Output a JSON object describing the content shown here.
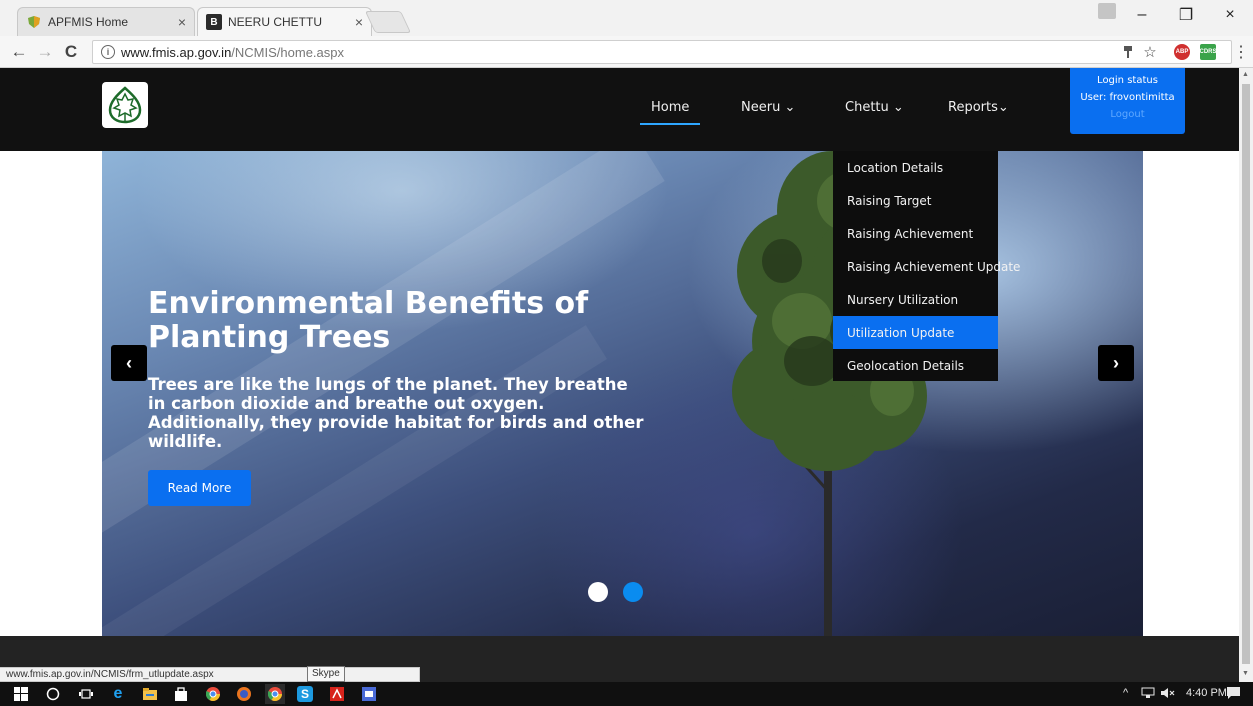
{
  "browser": {
    "tabs": [
      {
        "title": "APFMIS Home",
        "favicon": "shield-favicon",
        "close": "×"
      },
      {
        "title": "NEERU CHETTU",
        "favicon": "b-favicon",
        "favicon_letter": "B",
        "close": "×"
      }
    ],
    "window_controls": {
      "minimize": "–",
      "restore": "❐",
      "close": "×"
    },
    "nav": {
      "back": "←",
      "forward": "→",
      "reload": "C"
    },
    "url_host": "www.fmis.ap.gov.in",
    "url_path": "/NCMIS/home.aspx",
    "info_icon": "i",
    "toolbar_icons": {
      "key": "🗝",
      "star": "☆",
      "menu": "⋮",
      "abp": "ABP",
      "ext2": "CDRS"
    }
  },
  "site": {
    "nav": {
      "home": "Home",
      "neeru": "Neeru",
      "chettu": "Chettu",
      "reports": "Reports"
    },
    "login": {
      "status": "Login status",
      "user": "User: frovontimitta",
      "logout": "Logout"
    },
    "hero": {
      "title": "Environmental Benefits of Planting Trees",
      "text": "Trees are like the lungs of the planet. They breathe in carbon dioxide and breathe out oxygen. Additionally, they provide habitat for birds and other wildlife.",
      "button": "Read More",
      "prev": "‹",
      "next": "›"
    },
    "dropdown": [
      "Location Details",
      "Raising Target",
      "Raising Achievement",
      "Raising Achievement Update",
      "Nursery Utilization",
      "Utilization Update",
      "Geolocation Details"
    ],
    "dropdown_active": "Utilization Update",
    "status_url": "www.fmis.ap.gov.in/NCMIS/frm_utlupdate.aspx",
    "tooltip": "Skype"
  },
  "taskbar": {
    "time": "4:40 PM",
    "tray": "^",
    "colors": {
      "accent": "#0a6ff0",
      "nav_bg": "#111111"
    }
  }
}
